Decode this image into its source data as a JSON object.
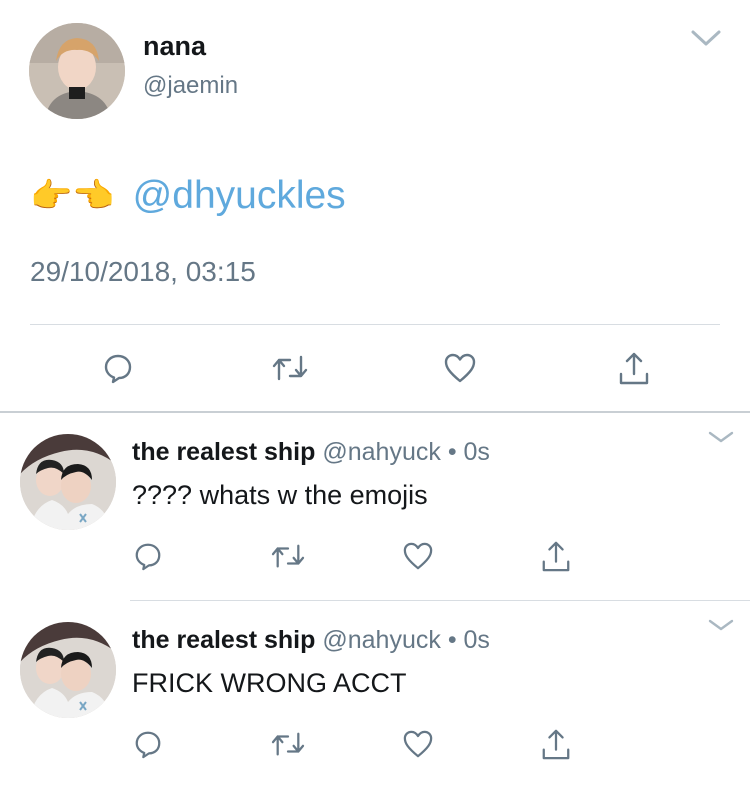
{
  "main_tweet": {
    "author_name": "nana",
    "author_handle": "@jaemin",
    "emojis": "👉👈",
    "mention": "@dhyuckles",
    "timestamp": "29/10/2018, 03:15"
  },
  "replies": [
    {
      "author_name": "the realest ship",
      "author_handle": "@nahyuck",
      "separator": "•",
      "time": "0s",
      "text": "???? whats w the emojis"
    },
    {
      "author_name": "the realest ship",
      "author_handle": "@nahyuck",
      "separator": "•",
      "time": "0s",
      "text": "FRICK WRONG ACCT"
    }
  ],
  "icons": {
    "reply": "reply-icon",
    "retweet": "retweet-icon",
    "like": "like-icon",
    "share": "share-icon",
    "menu": "chevron-down-icon"
  },
  "colors": {
    "link": "#5fa9dd",
    "secondary_text": "#657786",
    "icon": "#657786"
  }
}
